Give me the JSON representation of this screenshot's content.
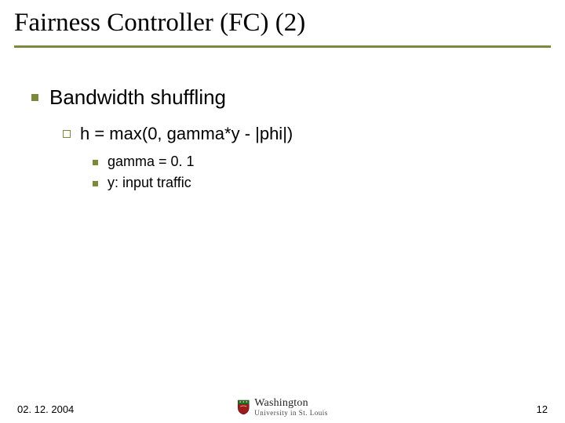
{
  "title": "Fairness Controller (FC) (2)",
  "bullets": {
    "l1": "Bandwidth shuffling",
    "l2": "h = max(0, gamma*y - |phi|)",
    "l3a": "gamma = 0. 1",
    "l3b": "y: input traffic"
  },
  "footer": {
    "date": "02. 12. 2004",
    "page": "12",
    "logo_top": "Washington",
    "logo_bot": "University in St. Louis"
  }
}
